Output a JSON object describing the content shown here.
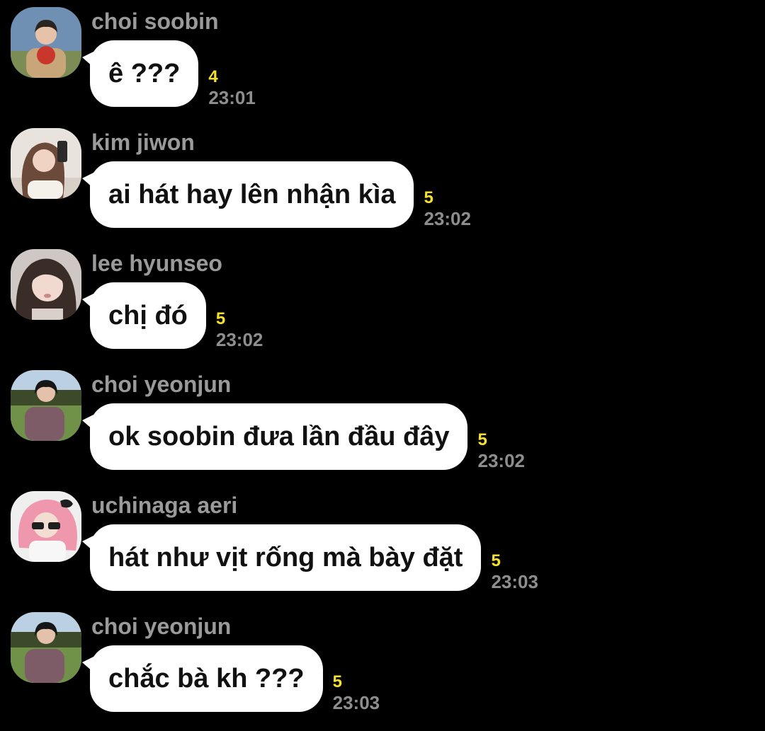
{
  "messages": [
    {
      "sender": "choi soobin",
      "text": "ê ???",
      "unread": "4",
      "time": "23:01",
      "avatar": {
        "bg": "#6f8fb3",
        "ground": "#7b8c54",
        "skin": "#e6c2a8",
        "hair": "#2a2520",
        "clothes": "#c9a67a",
        "accent": "#c9372c"
      }
    },
    {
      "sender": "kim jiwon",
      "text": "ai hát hay lên nhận kìa",
      "unread": "5",
      "time": "23:02",
      "avatar": {
        "bg": "#e9e3dd",
        "ground": "#d8cfc6",
        "skin": "#f1d3c4",
        "hair": "#6b4a3a",
        "clothes": "#f4f1ea",
        "accent": "#2b2b2b"
      }
    },
    {
      "sender": "lee hyunseo",
      "text": "chị đó",
      "unread": "5",
      "time": "23:02",
      "avatar": {
        "bg": "#cfc7c3",
        "ground": "#bfb6b0",
        "skin": "#f2d9cf",
        "hair": "#3a2c26",
        "clothes": "#d9d0ca",
        "accent": "#c98a86"
      }
    },
    {
      "sender": "choi yeonjun",
      "text": "ok soobin đưa lần đầu đây",
      "unread": "5",
      "time": "23:02",
      "avatar": {
        "bg": "#bcd0e3",
        "ground": "#6f9148",
        "skin": "#e3c1ab",
        "hair": "#161616",
        "clothes": "#7d5b67",
        "accent": "#3d4a2a"
      }
    },
    {
      "sender": "uchinaga aeri",
      "text": "hát như vịt rống mà bày đặt",
      "unread": "5",
      "time": "23:03",
      "avatar": {
        "bg": "#efefef",
        "ground": "#e2dede",
        "skin": "#f3ddd3",
        "hair": "#ef97ad",
        "clothes": "#f7f7f7",
        "accent": "#1e1e1e"
      }
    },
    {
      "sender": "choi yeonjun",
      "text": "chắc bà kh ???",
      "unread": "5",
      "time": "23:03",
      "avatar": {
        "bg": "#bcd0e3",
        "ground": "#6f9148",
        "skin": "#e3c1ab",
        "hair": "#161616",
        "clothes": "#7d5b67",
        "accent": "#3d4a2a"
      }
    }
  ]
}
